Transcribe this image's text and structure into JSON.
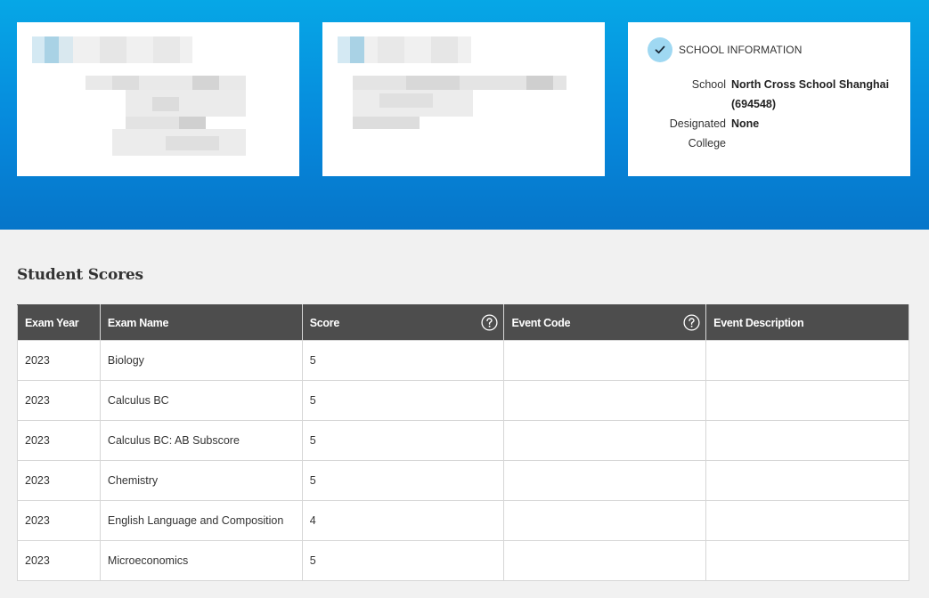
{
  "school_card": {
    "heading": "SCHOOL INFORMATION",
    "school_label": "School",
    "school_value_line1": "North Cross School Shanghai",
    "school_value_line2": "(694548)",
    "college_label_line1": "Designated",
    "college_label_line2": "College",
    "college_value": "None"
  },
  "scores": {
    "title": "Student Scores",
    "columns": [
      "Exam Year",
      "Exam Name",
      "Score",
      "Event Code",
      "Event Description"
    ],
    "rows": [
      {
        "year": "2023",
        "name": "Biology",
        "score": "5",
        "event_code": "",
        "event_description": ""
      },
      {
        "year": "2023",
        "name": "Calculus BC",
        "score": "5",
        "event_code": "",
        "event_description": ""
      },
      {
        "year": "2023",
        "name": "Calculus BC: AB Subscore",
        "score": "5",
        "event_code": "",
        "event_description": ""
      },
      {
        "year": "2023",
        "name": "Chemistry",
        "score": "5",
        "event_code": "",
        "event_description": ""
      },
      {
        "year": "2023",
        "name": "English Language and Composition",
        "score": "4",
        "event_code": "",
        "event_description": ""
      },
      {
        "year": "2023",
        "name": "Microeconomics",
        "score": "5",
        "event_code": "",
        "event_description": ""
      }
    ]
  },
  "icons": {
    "check": "check-icon",
    "help": "question-circle-icon"
  },
  "colors": {
    "hero_top": "#06a7e6",
    "hero_bottom": "#0675c9",
    "table_header": "#4d4d4d",
    "badge": "#9fd8f2"
  }
}
